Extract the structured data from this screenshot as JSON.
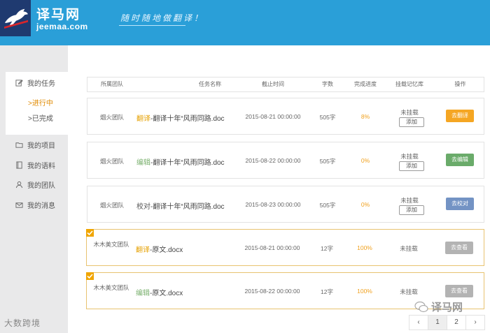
{
  "header": {
    "logo_cn": "译马网",
    "logo_en": "jeemaa.com",
    "slogan": "随时随地做翻译！"
  },
  "sidebar": {
    "my_tasks": "我的任务",
    "in_progress": ">进行中",
    "completed": ">已完成",
    "my_projects": "我的项目",
    "my_corpus": "我的语料",
    "my_team": "我的团队",
    "my_messages": "我的消息"
  },
  "table": {
    "headers": [
      "所属团队",
      "任务名称",
      "截止时间",
      "字数",
      "完成进度",
      "挂载记忆库",
      "操作"
    ],
    "rows": [
      {
        "team": "烟火团队",
        "type": "翻译",
        "name": "-翻译十年“风雨同路.doc",
        "deadline": "2015-08-21 00:00:00",
        "words": "505字",
        "progress": "8%",
        "memory": "未挂载",
        "add": "添加",
        "action": "去翻译",
        "action_color": "#f5a623",
        "selected": false
      },
      {
        "team": "烟火团队",
        "type": "编辑",
        "name": "-翻译十年“风雨同路.doc",
        "deadline": "2015-08-22 00:00:00",
        "words": "505字",
        "progress": "0%",
        "memory": "未挂载",
        "add": "添加",
        "action": "去编辑",
        "action_color": "#6aab6a",
        "selected": false
      },
      {
        "team": "烟火团队",
        "type": "校对",
        "name": "-翻译十年“风雨同路.doc",
        "deadline": "2015-08-23 00:00:00",
        "words": "505字",
        "progress": "0%",
        "memory": "未挂载",
        "add": "添加",
        "action": "去校对",
        "action_color": "#7393c4",
        "selected": false
      },
      {
        "team": "木木美文团队",
        "type": "翻译",
        "name": "-原文.docx",
        "deadline": "2015-08-21 00:00:00",
        "words": "12字",
        "progress": "100%",
        "memory": "未挂载",
        "add": "",
        "action": "去查看",
        "action_color": "#b3b3b3",
        "selected": true
      },
      {
        "team": "木木美文团队",
        "type": "编辑",
        "name": "-原文.docx",
        "deadline": "2015-08-22 00:00:00",
        "words": "12字",
        "progress": "100%",
        "memory": "未挂载",
        "add": "",
        "action": "去查看",
        "action_color": "#b3b3b3",
        "selected": true
      }
    ]
  },
  "pager": {
    "prev": "‹",
    "p1": "1",
    "p2": "2",
    "next": "›"
  },
  "watermark": {
    "left": "大数跨境",
    "right": "译马网"
  }
}
